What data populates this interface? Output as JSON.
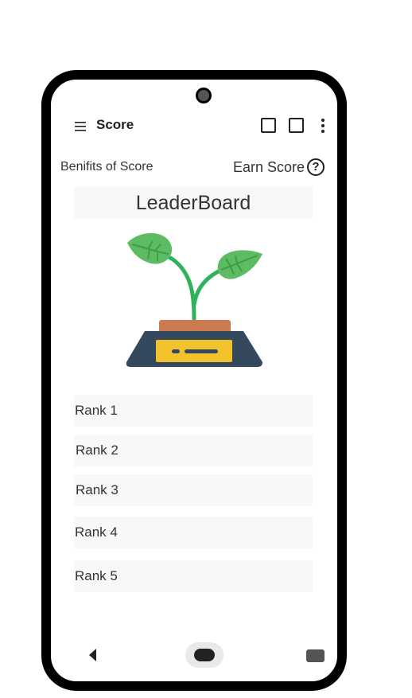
{
  "app_bar": {
    "title": "Score",
    "menu_icon": "hamburger-icon",
    "action_icons": [
      "square-icon",
      "square-icon",
      "more-vertical-icon"
    ]
  },
  "links": {
    "benefits_label": "Benifits of Score",
    "earn_label": "Earn Score",
    "help_icon_glyph": "?"
  },
  "leaderboard": {
    "title": "LeaderBoard",
    "illustration": "plant-on-scale-icon",
    "ranks": [
      "Rank 1",
      "Rank 2",
      "Rank 3",
      "Rank 4",
      "Rank 5"
    ]
  },
  "nav_bar": {
    "icons": [
      "back-icon",
      "home-icon",
      "recents-icon"
    ]
  },
  "colors": {
    "leaf": "#5dbb63",
    "stem": "#2fb35a",
    "pot_top": "#c97a4e",
    "scale_body": "#34495e",
    "display": "#f1c22c"
  }
}
